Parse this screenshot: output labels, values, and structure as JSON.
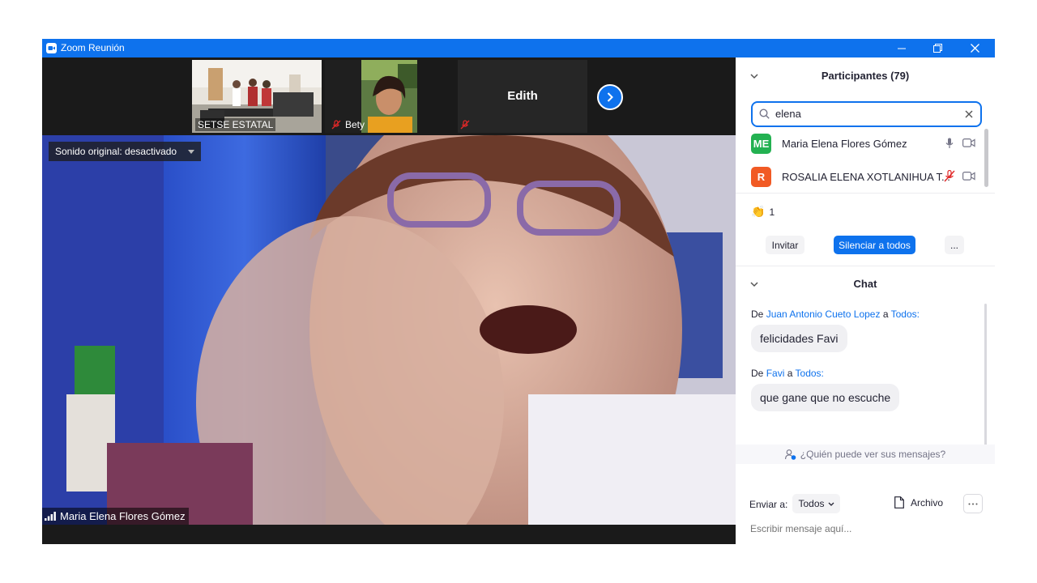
{
  "window": {
    "title": "Zoom Reunión"
  },
  "strip": {
    "thumbnails": [
      {
        "name": "SETSE ESTATAL"
      },
      {
        "name": "Bety"
      },
      {
        "name": "Edith"
      }
    ]
  },
  "main_video": {
    "sound_label": "Sonido original: desactivado",
    "speaker_name": "Maria Elena Flores Gómez"
  },
  "participants": {
    "title": "Participantes (79)",
    "search_value": "elena",
    "list": [
      {
        "initials": "ME",
        "name": "Maria Elena Flores Gómez",
        "color": "#23b151",
        "muted": false
      },
      {
        "initials": "R",
        "name": "ROSALIA ELENA XOTLANIHUA T...",
        "color": "#f15a24",
        "muted": true
      }
    ],
    "reactions": {
      "icon": "clapping-hands-icon",
      "count": "1"
    },
    "invite_label": "Invitar",
    "mute_all_label": "Silenciar a todos",
    "more_label": "..."
  },
  "chat": {
    "title": "Chat",
    "messages": [
      {
        "prefix": "De",
        "sender": "Juan Antonio Cueto Lopez",
        "connector": "a",
        "recipient": "Todos:",
        "text": "felicidades Favi"
      },
      {
        "prefix": "De",
        "sender": "Favi",
        "connector": "a",
        "recipient": "Todos:",
        "text": "que gane que no escuche"
      }
    ],
    "who_can_see": "¿Quién puede ver sus mensajes?",
    "send_to_label": "Enviar a:",
    "send_to_value": "Todos",
    "file_label": "Archivo",
    "input_placeholder": "Escribir mensaje aquí..."
  },
  "colors": {
    "accent": "#0e72ed",
    "mute_red": "#e02828"
  }
}
